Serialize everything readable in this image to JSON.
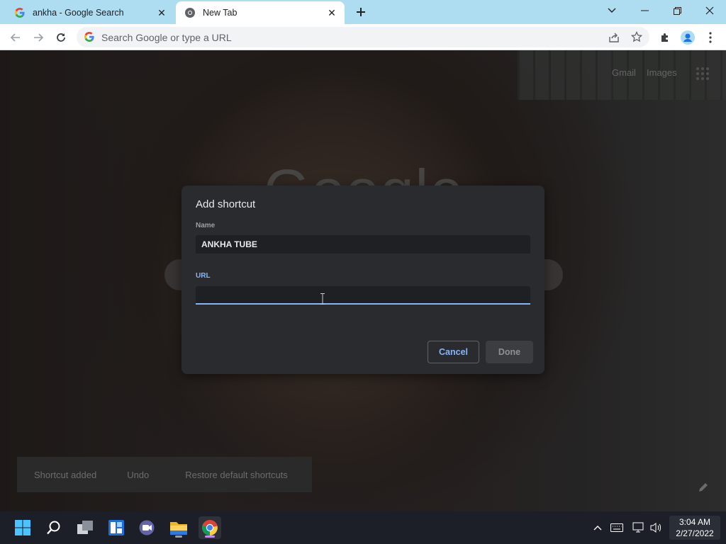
{
  "browser": {
    "tabs": [
      {
        "title": "ankha - Google Search",
        "favicon": "google-g-icon",
        "active": false
      },
      {
        "title": "New Tab",
        "favicon": "chrome-icon",
        "active": true
      }
    ],
    "omnibox": {
      "placeholder": "Search Google or type a URL",
      "value": ""
    }
  },
  "newtab": {
    "links": {
      "gmail": "Gmail",
      "images": "Images"
    },
    "logo_text": "Google",
    "toast": {
      "message": "Shortcut added",
      "undo": "Undo",
      "restore": "Restore default shortcuts"
    }
  },
  "dialog": {
    "title": "Add shortcut",
    "name_label": "Name",
    "name_value": "ANKHA TUBE",
    "url_label": "URL",
    "url_value": "",
    "cancel_label": "Cancel",
    "done_label": "Done"
  },
  "taskbar": {
    "time": "3:04 AM",
    "date": "2/27/2022"
  },
  "colors": {
    "tabstrip": "#aedcf0",
    "dialog_bg": "#2a2b2e",
    "accent": "#8ab4f8",
    "taskbar": "#1c1f27"
  }
}
